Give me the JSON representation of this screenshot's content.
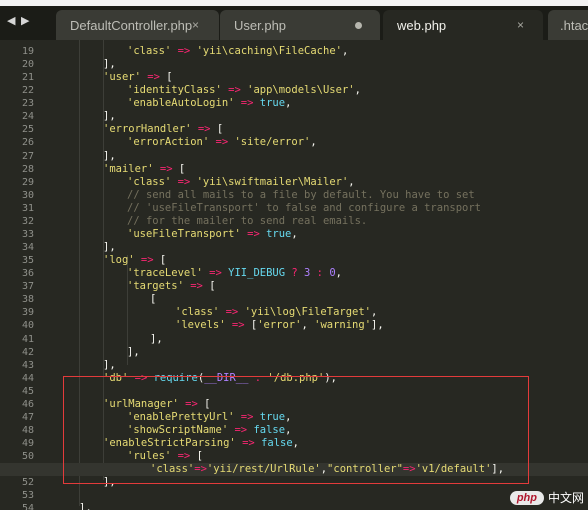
{
  "tabs": [
    {
      "label": "DefaultController.php",
      "state": "close"
    },
    {
      "label": "User.php",
      "state": "modified"
    },
    {
      "label": "web.php",
      "state": "active"
    },
    {
      "label": ".htacc",
      "state": "partial"
    }
  ],
  "close_glyph": "×",
  "nav": {
    "prev": "◀",
    "next": "▶"
  },
  "line_numbers": [
    "19",
    "20",
    "21",
    "22",
    "23",
    "24",
    "25",
    "26",
    "27",
    "28",
    "29",
    "30",
    "31",
    "32",
    "33",
    "34",
    "35",
    "36",
    "37",
    "38",
    "39",
    "40",
    "41",
    "42",
    "43",
    "44",
    "45",
    "46",
    "47",
    "48",
    "49",
    "50",
    "51",
    "52",
    "53",
    "54"
  ],
  "current_line": "51",
  "code": [
    [
      {
        "t": "'class'",
        "c": "s"
      },
      {
        "t": " => ",
        "c": "o"
      },
      {
        "t": "'yii\\caching\\FileCache'",
        "c": "s"
      },
      {
        "t": ",",
        "c": "p"
      }
    ],
    [
      {
        "t": "],",
        "c": "p"
      }
    ],
    [
      {
        "t": "'user'",
        "c": "s"
      },
      {
        "t": " => ",
        "c": "o"
      },
      {
        "t": "[",
        "c": "p"
      }
    ],
    [
      {
        "t": "'identityClass'",
        "c": "s"
      },
      {
        "t": " => ",
        "c": "o"
      },
      {
        "t": "'app\\models\\User'",
        "c": "s"
      },
      {
        "t": ",",
        "c": "p"
      }
    ],
    [
      {
        "t": "'enableAutoLogin'",
        "c": "s"
      },
      {
        "t": " => ",
        "c": "o"
      },
      {
        "t": "true",
        "c": "k"
      },
      {
        "t": ",",
        "c": "p"
      }
    ],
    [
      {
        "t": "],",
        "c": "p"
      }
    ],
    [
      {
        "t": "'errorHandler'",
        "c": "s"
      },
      {
        "t": " => ",
        "c": "o"
      },
      {
        "t": "[",
        "c": "p"
      }
    ],
    [
      {
        "t": "'errorAction'",
        "c": "s"
      },
      {
        "t": " => ",
        "c": "o"
      },
      {
        "t": "'site/error'",
        "c": "s"
      },
      {
        "t": ",",
        "c": "p"
      }
    ],
    [
      {
        "t": "],",
        "c": "p"
      }
    ],
    [
      {
        "t": "'mailer'",
        "c": "s"
      },
      {
        "t": " => ",
        "c": "o"
      },
      {
        "t": "[",
        "c": "p"
      }
    ],
    [
      {
        "t": "'class'",
        "c": "s"
      },
      {
        "t": " => ",
        "c": "o"
      },
      {
        "t": "'yii\\swiftmailer\\Mailer'",
        "c": "s"
      },
      {
        "t": ",",
        "c": "p"
      }
    ],
    [
      {
        "t": "// send all mails to a file by default. You have to set",
        "c": "c"
      }
    ],
    [
      {
        "t": "// 'useFileTransport' to false and configure a transport",
        "c": "c"
      }
    ],
    [
      {
        "t": "// for the mailer to send real emails.",
        "c": "c"
      }
    ],
    [
      {
        "t": "'useFileTransport'",
        "c": "s"
      },
      {
        "t": " => ",
        "c": "o"
      },
      {
        "t": "true",
        "c": "k"
      },
      {
        "t": ",",
        "c": "p"
      }
    ],
    [
      {
        "t": "],",
        "c": "p"
      }
    ],
    [
      {
        "t": "'log'",
        "c": "s"
      },
      {
        "t": " => ",
        "c": "o"
      },
      {
        "t": "[",
        "c": "p"
      }
    ],
    [
      {
        "t": "'traceLevel'",
        "c": "s"
      },
      {
        "t": " => ",
        "c": "o"
      },
      {
        "t": "YII_DEBUG",
        "c": "k"
      },
      {
        "t": " ? ",
        "c": "o"
      },
      {
        "t": "3",
        "c": "n"
      },
      {
        "t": " : ",
        "c": "o"
      },
      {
        "t": "0",
        "c": "n"
      },
      {
        "t": ",",
        "c": "p"
      }
    ],
    [
      {
        "t": "'targets'",
        "c": "s"
      },
      {
        "t": " => ",
        "c": "o"
      },
      {
        "t": "[",
        "c": "p"
      }
    ],
    [
      {
        "t": "[",
        "c": "p"
      }
    ],
    [
      {
        "t": "'class'",
        "c": "s"
      },
      {
        "t": " => ",
        "c": "o"
      },
      {
        "t": "'yii\\log\\FileTarget'",
        "c": "s"
      },
      {
        "t": ",",
        "c": "p"
      }
    ],
    [
      {
        "t": "'levels'",
        "c": "s"
      },
      {
        "t": " => ",
        "c": "o"
      },
      {
        "t": "[",
        "c": "p"
      },
      {
        "t": "'error'",
        "c": "s"
      },
      {
        "t": ", ",
        "c": "p"
      },
      {
        "t": "'warning'",
        "c": "s"
      },
      {
        "t": "],",
        "c": "p"
      }
    ],
    [
      {
        "t": "],",
        "c": "p"
      }
    ],
    [
      {
        "t": "],",
        "c": "p"
      }
    ],
    [
      {
        "t": "],",
        "c": "p"
      }
    ],
    [
      {
        "t": "'db'",
        "c": "s"
      },
      {
        "t": " => ",
        "c": "o"
      },
      {
        "t": "require",
        "c": "k"
      },
      {
        "t": "(",
        "c": "p"
      },
      {
        "t": "__DIR__",
        "c": "n"
      },
      {
        "t": " . ",
        "c": "o"
      },
      {
        "t": "'/db.php'",
        "c": "s"
      },
      {
        "t": "),",
        "c": "p"
      }
    ],
    [],
    [
      {
        "t": "'urlManager'",
        "c": "s"
      },
      {
        "t": " => ",
        "c": "o"
      },
      {
        "t": "[",
        "c": "p"
      }
    ],
    [
      {
        "t": "'enablePrettyUrl'",
        "c": "s"
      },
      {
        "t": " => ",
        "c": "o"
      },
      {
        "t": "true",
        "c": "k"
      },
      {
        "t": ",",
        "c": "p"
      }
    ],
    [
      {
        "t": "'showScriptName'",
        "c": "s"
      },
      {
        "t": " => ",
        "c": "o"
      },
      {
        "t": "false",
        "c": "k"
      },
      {
        "t": ",",
        "c": "p"
      }
    ],
    [
      {
        "t": "'enableStrictParsing'",
        "c": "s"
      },
      {
        "t": " => ",
        "c": "o"
      },
      {
        "t": "false",
        "c": "k"
      },
      {
        "t": ",",
        "c": "p"
      }
    ],
    [
      {
        "t": "'rules'",
        "c": "s"
      },
      {
        "t": " => ",
        "c": "o"
      },
      {
        "t": "[",
        "c": "p"
      }
    ],
    [
      {
        "t": "'class'",
        "c": "s"
      },
      {
        "t": "=>",
        "c": "o"
      },
      {
        "t": "'yii/rest/UrlRule'",
        "c": "s"
      },
      {
        "t": ",",
        "c": "p"
      },
      {
        "t": "\"controller\"",
        "c": "s"
      },
      {
        "t": "=>",
        "c": "o"
      },
      {
        "t": "'v1/default'",
        "c": "s"
      },
      {
        "t": "],",
        "c": "p"
      }
    ],
    [
      {
        "t": "],",
        "c": "p"
      }
    ],
    [],
    [
      {
        "t": "],",
        "c": "p"
      }
    ]
  ],
  "watermark": {
    "badge": "php",
    "text": "中文网"
  },
  "colors": {
    "background": "#272822",
    "string": "#e6db74",
    "operator": "#f92672",
    "keyword": "#66d9ef",
    "number": "#ae81ff",
    "comment": "#75715e",
    "highlight_box": "#e33b3b"
  }
}
